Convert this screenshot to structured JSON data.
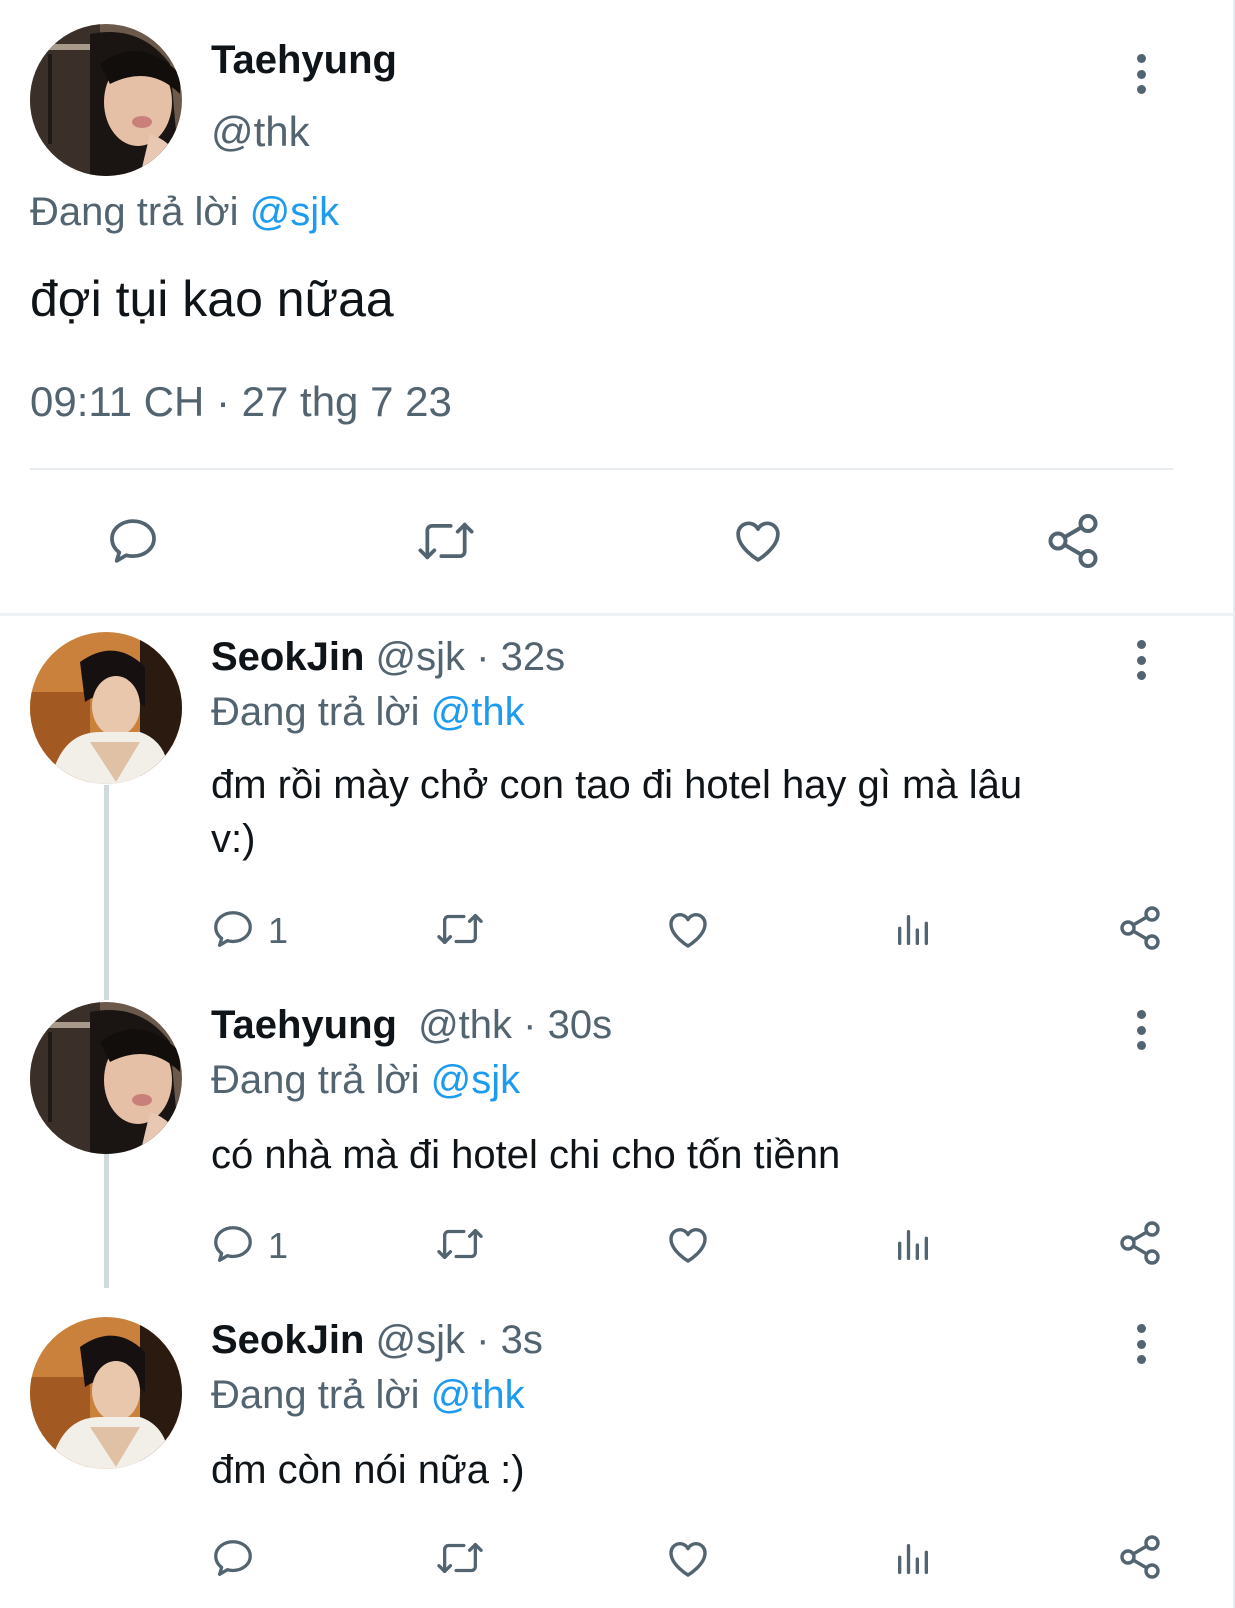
{
  "main_tweet": {
    "author_name": "Taehyung",
    "author_handle": "@thk",
    "replying_prefix": "Đang trả lời",
    "replying_to": "@sjk",
    "text": "đợi tụi kao nữaa",
    "timestamp": "09:11 CH · 27 thg 7 23",
    "actions": [
      "reply-icon",
      "retweet-icon",
      "like-icon",
      "share-icon"
    ]
  },
  "replies": [
    {
      "author_name": "SeokJin",
      "author_handle": "@sjk",
      "time": "· 32s",
      "replying_prefix": "Đang trả lời",
      "replying_to": "@thk",
      "text_line1": "đm rồi mày chở con tao đi hotel hay gì mà lâu",
      "text_line2": "v:)",
      "reply_count": "1"
    },
    {
      "author_name": "Taehyung",
      "author_handle": "@thk",
      "time": "· 30s",
      "replying_prefix": "Đang trả lời",
      "replying_to": "@sjk",
      "text_line1": "có nhà mà đi hotel chi cho tốn tiềnn",
      "text_line2": "",
      "reply_count": "1"
    },
    {
      "author_name": "SeokJin",
      "author_handle": "@sjk",
      "time": "· 3s",
      "replying_prefix": "Đang trả lời",
      "replying_to": "@thk",
      "text_line1": "đm còn nói nữa :)",
      "text_line2": "",
      "reply_count": ""
    }
  ],
  "colors": {
    "text": "#0f1419",
    "muted": "#536471",
    "link": "#1d9bf0",
    "divider": "#e6ecf0"
  }
}
